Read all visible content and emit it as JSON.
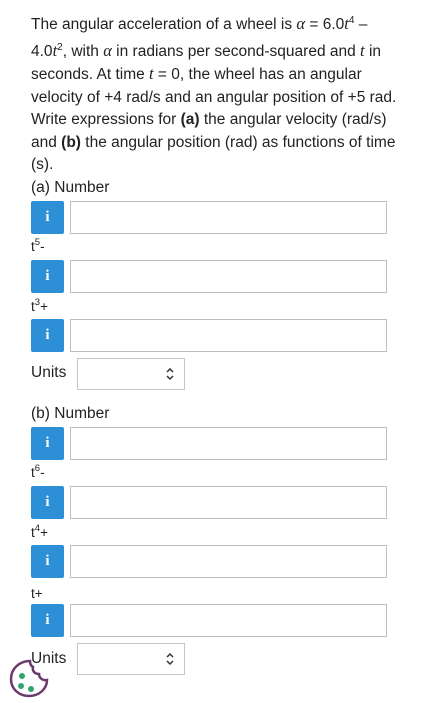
{
  "question": {
    "line1a": "The angular acceleration of a wheel is ",
    "alpha_sym": "α",
    "eq1": " = 6.0",
    "t1": "t",
    "exp4": "4",
    "dash": " –",
    "line2a": "4.0",
    "t2": "t",
    "exp2": "2",
    "line2b": ", with ",
    "alpha2": "α",
    "line2c": " in radians per second-squared and ",
    "t3": "t",
    "line2d": " in",
    "line3": "seconds. At time ",
    "t4": "t",
    "line3b": " = 0, the wheel has an angular",
    "line4": "velocity of +4 rad/s and an angular position of +5 rad.",
    "line5": "Write expressions for ",
    "part_a": "(a)",
    "line5b": " the angular velocity (rad/s)",
    "line6a": "and ",
    "part_b": "(b)",
    "line6b": " the angular position (rad) as functions of time",
    "line7": "(s)."
  },
  "part_a": {
    "label": "(a) Number",
    "terms": [
      {
        "base": "t",
        "exp": "5",
        "suffix": "-"
      },
      {
        "base": "t",
        "exp": "3",
        "suffix": "+"
      }
    ],
    "units_label": "Units",
    "units_value": ""
  },
  "part_b": {
    "label": "(b) Number",
    "terms": [
      {
        "base": "t",
        "exp": "6",
        "suffix": "-"
      },
      {
        "base": "t",
        "exp": "4",
        "suffix": "+"
      },
      {
        "base": "t",
        "exp": "",
        "suffix": "+"
      }
    ],
    "units_label": "Units",
    "units_value": ""
  },
  "info_button_label": "i",
  "icons": {
    "info": "info-icon",
    "select": "up-down-chevron-icon",
    "feedback": "cookie-icon"
  },
  "colors": {
    "info_button": "#2d8fd5",
    "field_border": "#bfbfbf",
    "text": "#222222"
  }
}
